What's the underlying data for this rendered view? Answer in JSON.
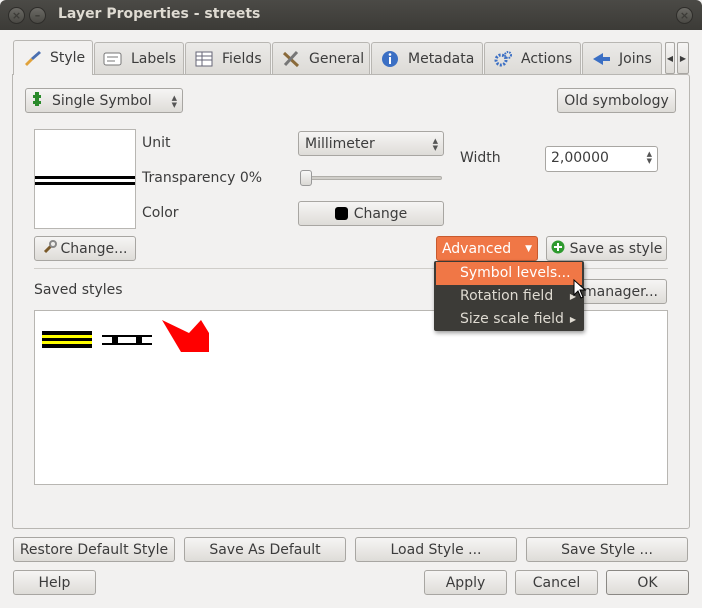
{
  "window": {
    "title": "Layer Properties - streets",
    "close_glyph": "×",
    "minimize_glyph": "–"
  },
  "tabs": [
    {
      "label": "Style",
      "icon": "brush-icon"
    },
    {
      "label": "Labels",
      "icon": "label-icon"
    },
    {
      "label": "Fields",
      "icon": "table-icon"
    },
    {
      "label": "General",
      "icon": "tools-icon"
    },
    {
      "label": "Metadata",
      "icon": "info-icon"
    },
    {
      "label": "Actions",
      "icon": "gears-icon"
    },
    {
      "label": "Joins",
      "icon": "join-icon"
    }
  ],
  "style": {
    "renderer": "Single Symbol",
    "old_symbology": "Old symbology",
    "unit_label": "Unit",
    "unit_value": "Millimeter",
    "transparency_label": "Transparency 0%",
    "transparency_value": 0,
    "color_label": "Color",
    "color_button": "Change",
    "width_label": "Width",
    "width_value": "2,00000",
    "change_button": "Change...",
    "advanced_button": "Advanced",
    "save_as_style": "Save as style",
    "saved_styles_label": "Saved styles",
    "style_manager_button": "manager..."
  },
  "advanced_menu": [
    {
      "label": "Symbol levels...",
      "highlighted": true,
      "submenu": false
    },
    {
      "label": "Rotation field",
      "highlighted": false,
      "submenu": true
    },
    {
      "label": "Size scale field",
      "highlighted": false,
      "submenu": true
    }
  ],
  "bottom": {
    "restore_default": "Restore Default Style",
    "save_as_default": "Save As Default",
    "load_style": "Load Style ...",
    "save_style": "Save Style ...",
    "help": "Help",
    "apply": "Apply",
    "cancel": "Cancel",
    "ok": "OK"
  },
  "colors": {
    "accent": "#f07746",
    "menu_bg": "#3c3b37",
    "titlebar": "#3c3b37"
  }
}
